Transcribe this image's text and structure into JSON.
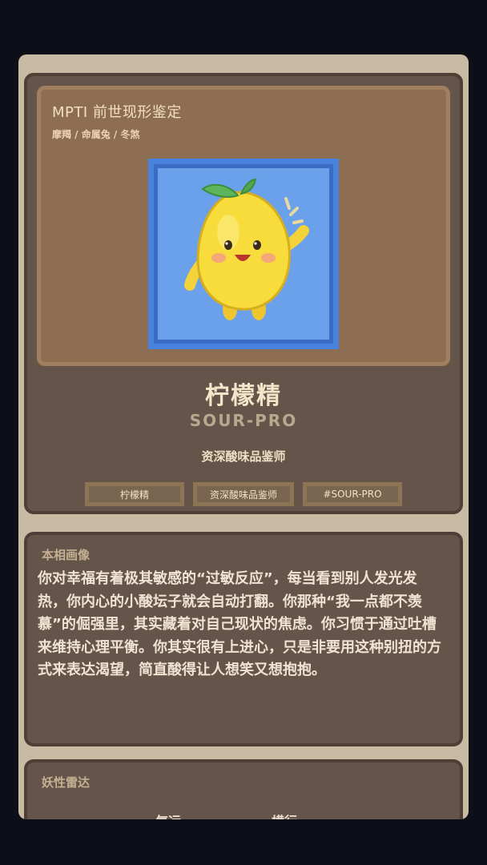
{
  "hero": {
    "title": "MPTI 前世现形鉴定",
    "subtitle": "摩羯 / 命属兔 / 冬煞"
  },
  "character": {
    "name": "柠檬精",
    "code": "SOUR-PRO",
    "role": "资深酸味品鉴师",
    "tags": [
      "柠檬精",
      "资深酸味品鉴师",
      "#SOUR-PRO"
    ]
  },
  "portrait": {
    "icon": "lemon-character-icon",
    "frame_color": "#4a82e0",
    "bg_color": "#6aa1ea"
  },
  "description": {
    "title": "本相画像",
    "text": "你对幸福有着极其敏感的“过敏反应”，每当看到别人发光发热，你内心的小酸坛子就会自动打翻。你那种“我一点都不羡慕”的倔强里，其实藏着对自己现状的焦虑。你习惯于通过吐槽来维持心理平衡。你其实很有上进心，只是非要用这种别扭的方式来表达渴望，简直酸得让人想笑又想抱抱。"
  },
  "radar": {
    "title": "妖性雷达",
    "axes": [
      "气运",
      "横行"
    ]
  },
  "colors": {
    "page_bg": "#0d0e17",
    "card_bg": "#64544a",
    "accent": "#f4e4c8"
  }
}
